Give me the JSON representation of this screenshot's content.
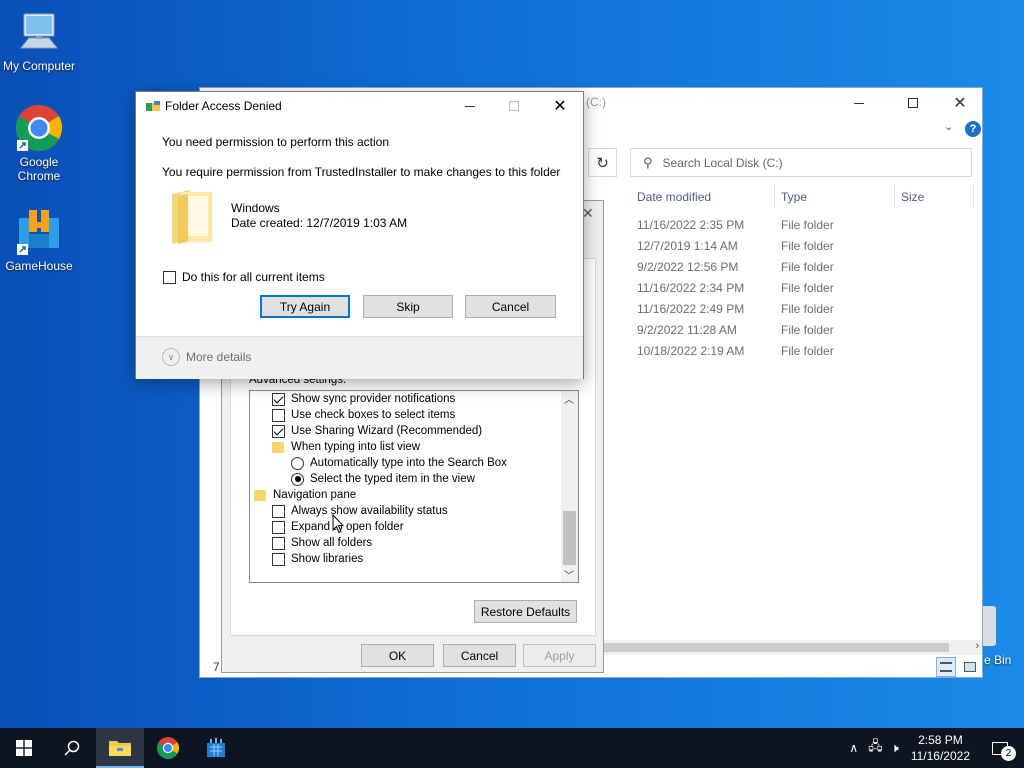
{
  "desktop": {
    "icons": [
      {
        "label": "My Computer",
        "icon": "computer-icon"
      },
      {
        "label": "Google Chrome",
        "icon": "chrome-icon"
      },
      {
        "label": "GameHouse",
        "icon": "gamehouse-icon"
      },
      {
        "label": "e Bin",
        "icon": "recycle-bin-icon"
      }
    ]
  },
  "explorer": {
    "title": "(C:)",
    "search_placeholder": "Search Local Disk (C:)",
    "columns": {
      "date": "Date modified",
      "type": "Type",
      "size": "Size"
    },
    "rows": [
      {
        "date": "11/16/2022 2:35 PM",
        "type": "File folder"
      },
      {
        "date": "12/7/2019 1:14 AM",
        "type": "File folder"
      },
      {
        "date": "9/2/2022 12:56 PM",
        "type": "File folder"
      },
      {
        "date": "11/16/2022 2:34 PM",
        "type": "File folder"
      },
      {
        "date": "11/16/2022 2:49 PM",
        "type": "File folder"
      },
      {
        "date": "9/2/2022 11:28 AM",
        "type": "File folder"
      },
      {
        "date": "10/18/2022 2:19 AM",
        "type": "File folder"
      }
    ],
    "status_count": "7"
  },
  "folder_options": {
    "advanced_label": "Advanced settings:",
    "items": [
      {
        "kind": "checkbox",
        "checked": true,
        "indent": 1,
        "label": "Show sync provider notifications"
      },
      {
        "kind": "checkbox",
        "checked": false,
        "indent": 1,
        "label": "Use check boxes to select items"
      },
      {
        "kind": "checkbox",
        "checked": true,
        "indent": 1,
        "label": "Use Sharing Wizard (Recommended)"
      },
      {
        "kind": "folder",
        "indent": 1,
        "label": "When typing into list view"
      },
      {
        "kind": "radio",
        "checked": false,
        "indent": 2,
        "label": "Automatically type into the Search Box"
      },
      {
        "kind": "radio",
        "checked": true,
        "indent": 2,
        "label": "Select the typed item in the view"
      },
      {
        "kind": "folder",
        "indent": 0,
        "label": "Navigation pane"
      },
      {
        "kind": "checkbox",
        "checked": false,
        "indent": 1,
        "label": "Always show availability status"
      },
      {
        "kind": "checkbox",
        "checked": false,
        "indent": 1,
        "label": "Expand to open folder"
      },
      {
        "kind": "checkbox",
        "checked": false,
        "indent": 1,
        "label": "Show all folders"
      },
      {
        "kind": "checkbox",
        "checked": false,
        "indent": 1,
        "label": "Show libraries"
      }
    ],
    "restore_label": "Restore Defaults",
    "ok_label": "OK",
    "cancel_label": "Cancel",
    "apply_label": "Apply"
  },
  "denied_dialog": {
    "title": "Folder Access Denied",
    "heading": "You need permission to perform this action",
    "message": "You require permission from TrustedInstaller to make changes to this folder",
    "folder_name": "Windows",
    "folder_date": "Date created: 12/7/2019 1:03 AM",
    "checkbox_label": "Do this for all current items",
    "try_again_label": "Try Again",
    "skip_label": "Skip",
    "cancel_label": "Cancel",
    "more_details_label": "More details"
  },
  "taskbar": {
    "time": "2:58 PM",
    "date": "11/16/2022",
    "notification_count": "2"
  }
}
